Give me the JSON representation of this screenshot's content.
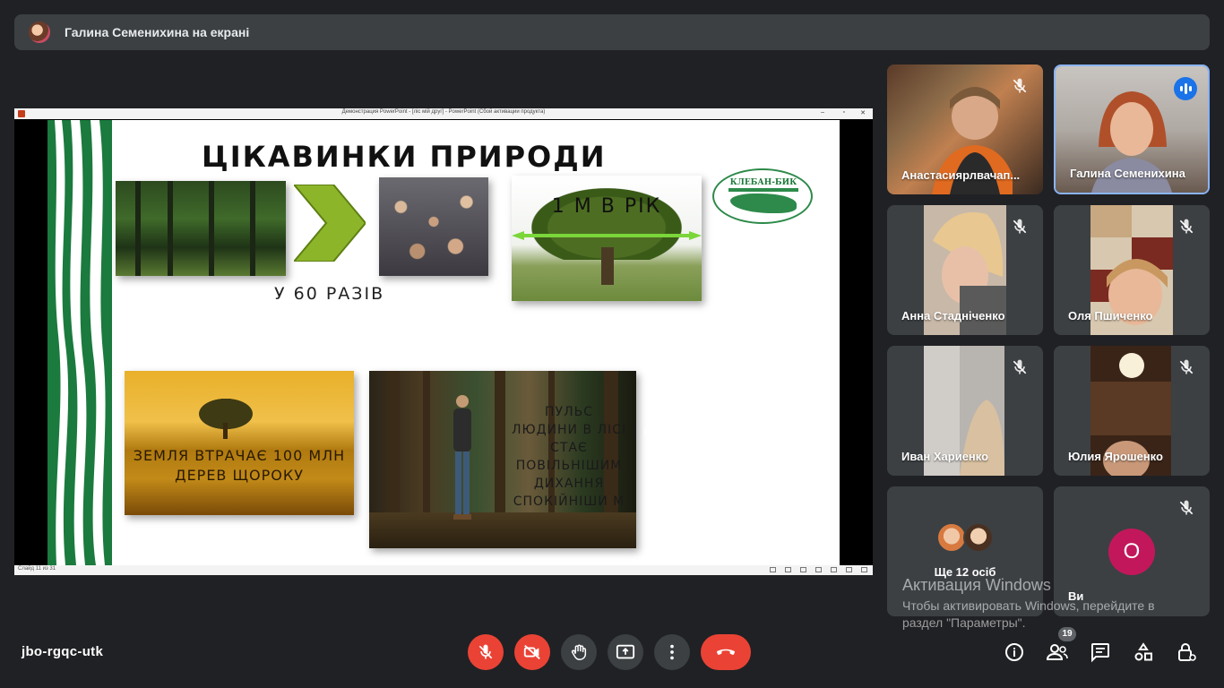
{
  "banner": {
    "text": "Галина Семенихина на екрані"
  },
  "window": {
    "title": "Демонстрация PowerPoint - [ліс мій друг] - PowerPoint (Сбой активации продукта)",
    "minimize": "–",
    "maximize": "▫",
    "close": "✕",
    "status": "Слайд 11 из 31"
  },
  "slide": {
    "title": "ЦІКАВИНКИ ПРИРОДИ",
    "times_label": "У 60 РАЗІВ",
    "tree_label": "1 М В РІК",
    "logo_text": "КЛЕБАН-БИК",
    "field_label": "ЗЕМЛЯ ВТРАЧАЄ 100 МЛН ДЕРЕВ ЩОРОКУ",
    "woods_label": "ПУЛЬС ЛЮДИНИ В ЛІСІ СТАЄ ПОВІЛЬНІШИМ ДИХАННЯ СПОКІЙНІШИ М"
  },
  "participants": [
    {
      "name": "Анастасиярлвачап...",
      "muted": true
    },
    {
      "name": "Галина Семенихина",
      "muted": false,
      "speaking": true
    },
    {
      "name": "Анна Стадніченко",
      "muted": true
    },
    {
      "name": "Оля Пшиченко",
      "muted": true
    },
    {
      "name": "Иван Хариенко",
      "muted": true
    },
    {
      "name": "Юлия Ярошенко",
      "muted": true
    }
  ],
  "more_tile": {
    "label": "Ще 12 осіб"
  },
  "self_tile": {
    "initial": "О",
    "label": "Ви"
  },
  "watermark": {
    "title": "Активация Windows",
    "subtitle": "Чтобы активировать Windows, перейдите в раздел \"Параметры\"."
  },
  "footer": {
    "meeting_code": "jbo-rgqc-utk",
    "people_count": "19"
  },
  "colors": {
    "background": "#202124",
    "tile": "#3c4043",
    "danger": "#ea4335",
    "speaking_accent": "#1a73e8",
    "self_avatar": "#c2185b"
  },
  "icons": {
    "mic": "mic-off-icon",
    "camera": "camera-off-icon",
    "hand": "raise-hand-icon",
    "present": "present-screen-icon",
    "more": "more-vert-icon",
    "hangup": "hang-up-icon",
    "info": "info-icon",
    "people": "people-icon",
    "chat": "chat-icon",
    "activities": "activities-icon",
    "lock": "host-controls-icon"
  }
}
